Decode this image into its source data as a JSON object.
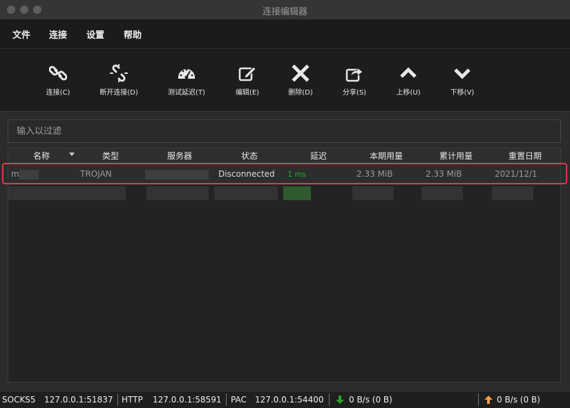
{
  "window": {
    "title": "连接编辑器"
  },
  "menu": {
    "file": "文件",
    "connect": "连接",
    "settings": "设置",
    "help": "帮助"
  },
  "toolbar": {
    "connect": "连接(C)",
    "disconnect": "断开连接(D)",
    "test_latency": "测试延迟(T)",
    "edit": "编辑(E)",
    "delete": "删除(D)",
    "share": "分享(S)",
    "move_up": "上移(U)",
    "move_down": "下移(V)"
  },
  "filter": {
    "placeholder": "输入以过滤"
  },
  "table": {
    "columns": [
      "名称",
      "类型",
      "服务器",
      "状态",
      "延迟",
      "本期用量",
      "累计用量",
      "重置日期"
    ],
    "rows": [
      {
        "name": "m",
        "type": "TROJAN",
        "server": "",
        "status": "Disconnected",
        "latency": "1 ms",
        "period_usage": "2.33  MiB",
        "total_usage": "2.33  MiB",
        "reset_date": "2021/12/1"
      }
    ]
  },
  "status": {
    "socks_label": "SOCKS5",
    "socks_addr": "127.0.0.1:51837",
    "http_label": "HTTP",
    "http_addr": "127.0.0.1:58591",
    "pac_label": "PAC",
    "pac_addr": "127.0.0.1:54400",
    "download": "0 B/s (0 B)",
    "upload": "0 B/s (0 B)"
  },
  "colors": {
    "latency_good": "#1fae2e",
    "highlight": "#e0394d",
    "download_arrow": "#2aa52a",
    "upload_arrow": "#f0a03c"
  }
}
